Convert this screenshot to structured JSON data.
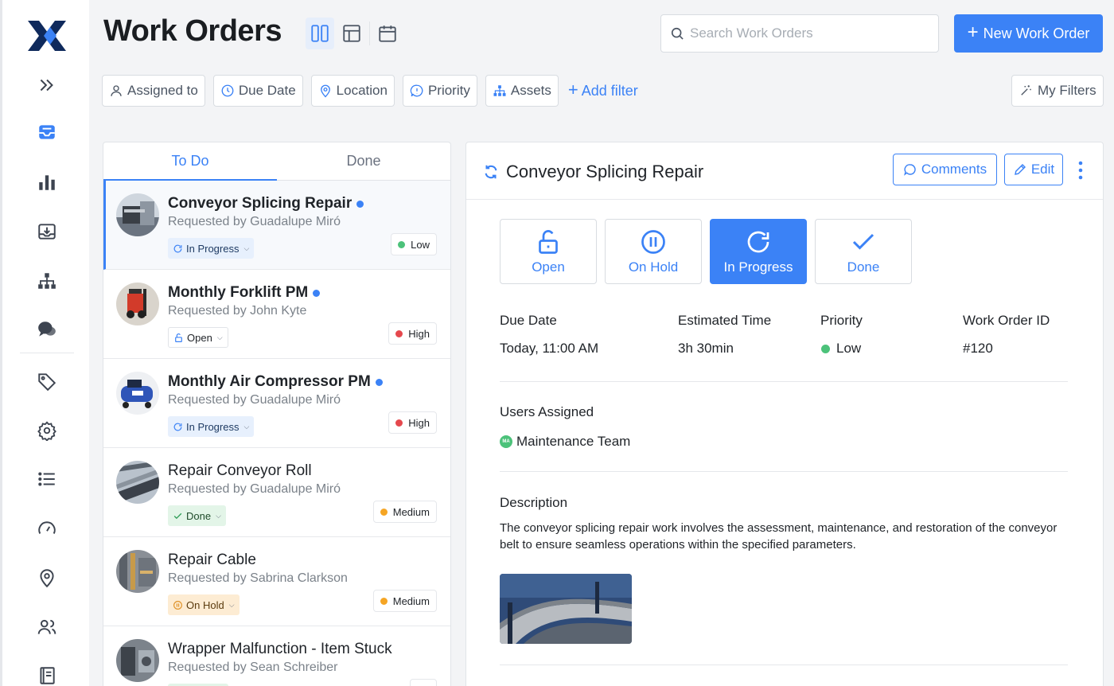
{
  "app": {
    "logo": "x-logo",
    "accent": "#3b82f6"
  },
  "sidebar": {
    "icons": [
      "expand-icon",
      "inbox-icon",
      "bar-chart-icon",
      "download-tray-icon",
      "hierarchy-icon",
      "chat-icon",
      "tag-icon",
      "gear-icon",
      "list-icon",
      "gauge-icon",
      "location-pin-icon",
      "users-icon",
      "book-icon"
    ]
  },
  "header": {
    "title": "Work Orders",
    "view_modes": [
      "split-view-icon",
      "table-view-icon",
      "calendar-view-icon"
    ],
    "search_placeholder": "Search Work Orders",
    "new_button": "New Work Order"
  },
  "filters": {
    "items": [
      {
        "label": "Assigned to",
        "icon": "user-icon"
      },
      {
        "label": "Due Date",
        "icon": "clock-icon"
      },
      {
        "label": "Location",
        "icon": "location-pin-icon"
      },
      {
        "label": "Priority",
        "icon": "alert-bubble-icon"
      },
      {
        "label": "Assets",
        "icon": "hierarchy-icon"
      }
    ],
    "add_filter": "Add filter",
    "my_filters": "My Filters"
  },
  "list": {
    "tabs": [
      {
        "label": "To Do",
        "active": true
      },
      {
        "label": "Done",
        "active": false
      }
    ],
    "items": [
      {
        "title": "Conveyor Splicing Repair",
        "requested": "Requested by Guadalupe Miró",
        "status": "In Progress",
        "priority": "Low",
        "priority_color": "#4cc27a",
        "unread": true
      },
      {
        "title": "Monthly Forklift PM",
        "requested": "Requested by John Kyte",
        "status": "Open",
        "priority": "High",
        "priority_color": "#e5484d",
        "unread": true
      },
      {
        "title": "Monthly Air Compressor PM",
        "requested": "Requested by Guadalupe Miró",
        "status": "In Progress",
        "priority": "High",
        "priority_color": "#e5484d",
        "unread": true
      },
      {
        "title": "Repair Conveyor Roll",
        "requested": "Requested by Guadalupe Miró",
        "status": "Done",
        "priority": "Medium",
        "priority_color": "#f5a524",
        "unread": false
      },
      {
        "title": "Repair Cable",
        "requested": "Requested by Sabrina Clarkson",
        "status": "On Hold",
        "priority": "Medium",
        "priority_color": "#f5a524",
        "unread": false
      },
      {
        "title": "Wrapper Malfunction - Item Stuck",
        "requested": "Requested by Sean Schreiber",
        "status": "",
        "priority": "",
        "priority_color": "#4cc27a",
        "unread": false
      }
    ]
  },
  "detail": {
    "title": "Conveyor Splicing Repair",
    "comments_button": "Comments",
    "edit_button": "Edit",
    "status_buttons": [
      {
        "label": "Open",
        "active": false
      },
      {
        "label": "On Hold",
        "active": false
      },
      {
        "label": "In Progress",
        "active": true
      },
      {
        "label": "Done",
        "active": false
      }
    ],
    "meta": [
      {
        "label": "Due Date",
        "value": "Today, 11:00 AM"
      },
      {
        "label": "Estimated Time",
        "value": "3h 30min"
      },
      {
        "label": "Priority",
        "value": "Low"
      },
      {
        "label": "Work Order ID",
        "value": "#120"
      }
    ],
    "users_label": "Users Assigned",
    "user": {
      "initials": "MA",
      "name": "Maintenance Team"
    },
    "description_label": "Description",
    "description": "The conveyor splicing repair work involves the assessment, maintenance, and restoration of the conveyor belt to ensure seamless operations within the specified parameters."
  }
}
